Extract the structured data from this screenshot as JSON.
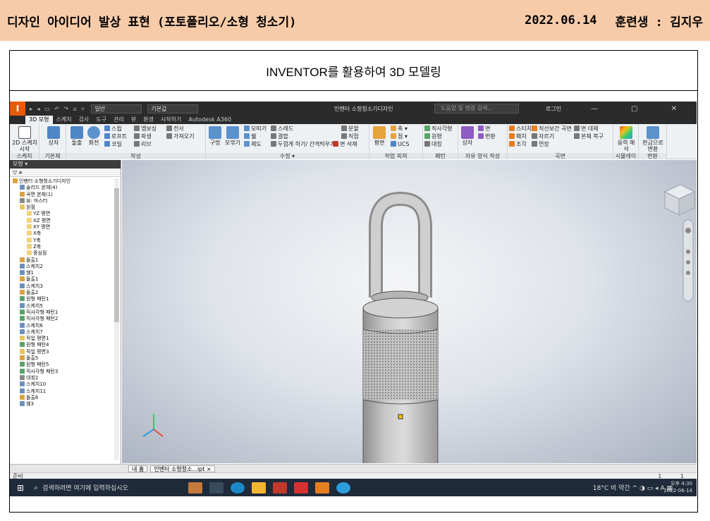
{
  "header": {
    "title": "디자인 아이디어 발상 표현 (포토폴리오/소형 청소기)",
    "date": "2022.06.14",
    "trainee": "훈련생 : 김지우"
  },
  "caption": "INVENTOR를 활용하여 3D 모델링",
  "app": {
    "logo": "I",
    "quick_access": "▸ ◂ ▭ ↶ ↷ ⌂ ▿",
    "material_select": "일반",
    "appearance_select": "기본값",
    "title": "인벤터 소형청소기디자인",
    "search_placeholder": "도움말 및 명령 검색...",
    "login": "로그인",
    "window_controls": "— ▢ ✕"
  },
  "tabs": [
    "3D 모형",
    "스케치",
    "검사",
    "도구",
    "관리",
    "뷰",
    "환경",
    "시작하기",
    "Autodesk A360"
  ],
  "active_tab": "3D 모형",
  "ribbon": {
    "groups": [
      {
        "id": "sketch",
        "label": "스케치",
        "buttons": [
          "2D 스케치 시작"
        ]
      },
      {
        "id": "base",
        "label": "기본체",
        "buttons": [
          "상자"
        ]
      },
      {
        "id": "create",
        "label": "작성",
        "buttons": [
          "돌출",
          "회전"
        ],
        "small": [
          "스윕",
          "로프트",
          "코일",
          "엠보싱",
          "파생",
          "리브",
          "전사",
          "가져오기"
        ]
      },
      {
        "id": "modify",
        "label": "수정 ▾",
        "buttons": [
          "구멍",
          "모깎기"
        ],
        "small": [
          "모따기",
          "쉘",
          "제도",
          "스레드",
          "결합",
          "두껍게 하기/ 간격띄우기",
          "분할",
          "직접",
          "면 삭제"
        ]
      },
      {
        "id": "work",
        "label": "작업 피쳐",
        "buttons": [
          "평면"
        ],
        "small": [
          "축 ▾",
          "점 ▾",
          "UCS"
        ]
      },
      {
        "id": "pattern",
        "label": "패턴",
        "small": [
          "직사각형",
          "원형",
          "대칭"
        ]
      },
      {
        "id": "freeform",
        "label": "자유 양식 작성",
        "buttons": [
          "상자"
        ],
        "small": [
          "면",
          "변환"
        ]
      },
      {
        "id": "surface",
        "label": "곡면",
        "small": [
          "스티치",
          "패치",
          "조각",
          "직선보간 곡면",
          "자르기",
          "연장",
          "면 대체",
          "본체 복구"
        ]
      },
      {
        "id": "sim",
        "label": "시뮬레이션",
        "buttons": [
          "응력 해석"
        ]
      },
      {
        "id": "convert",
        "label": "변환",
        "buttons": [
          "판금으로 변환"
        ]
      }
    ]
  },
  "browser": {
    "header": "모형 ▾",
    "tree": [
      {
        "label": "인벤터 소형청소기디자인",
        "depth": 0,
        "color": "#d9a441"
      },
      {
        "label": "솔리드 본체(4)",
        "depth": 1,
        "color": "#6b8fbf"
      },
      {
        "label": "곡면 본체(1)",
        "depth": 1,
        "color": "#d9a441"
      },
      {
        "label": "뷰: 마스터",
        "depth": 1,
        "color": "#888888"
      },
      {
        "label": "원점",
        "depth": 1,
        "color": "#e8c35a"
      },
      {
        "label": "YZ 평면",
        "depth": 2,
        "color": "#f2d27a"
      },
      {
        "label": "XZ 평면",
        "depth": 2,
        "color": "#f2d27a"
      },
      {
        "label": "XY 평면",
        "depth": 2,
        "color": "#f2d27a"
      },
      {
        "label": "X축",
        "depth": 2,
        "color": "#f2d27a"
      },
      {
        "label": "Y축",
        "depth": 2,
        "color": "#f2d27a"
      },
      {
        "label": "Z축",
        "depth": 2,
        "color": "#f2d27a"
      },
      {
        "label": "중심점",
        "depth": 2,
        "color": "#f2d27a"
      },
      {
        "label": "돌출1",
        "depth": 1,
        "color": "#d9a441"
      },
      {
        "label": "스케치2",
        "depth": 1,
        "color": "#6b8fbf"
      },
      {
        "label": "쉘1",
        "depth": 1,
        "color": "#6b8fbf"
      },
      {
        "label": "돌출1",
        "depth": 1,
        "color": "#d9a441"
      },
      {
        "label": "스케치3",
        "depth": 1,
        "color": "#6b8fbf"
      },
      {
        "label": "돌출2",
        "depth": 1,
        "color": "#d9a441"
      },
      {
        "label": "원형 패턴1",
        "depth": 1,
        "color": "#5aa36b"
      },
      {
        "label": "스케치5",
        "depth": 1,
        "color": "#6b8fbf"
      },
      {
        "label": "직사각형 패턴1",
        "depth": 1,
        "color": "#5aa36b"
      },
      {
        "label": "직사각형 패턴2",
        "depth": 1,
        "color": "#5aa36b"
      },
      {
        "label": "스케치6",
        "depth": 1,
        "color": "#6b8fbf"
      },
      {
        "label": "스케치7",
        "depth": 1,
        "color": "#6b8fbf"
      },
      {
        "label": "작업 평면1",
        "depth": 1,
        "color": "#e8c35a"
      },
      {
        "label": "원형 패턴4",
        "depth": 1,
        "color": "#5aa36b"
      },
      {
        "label": "작업 평면3",
        "depth": 1,
        "color": "#e8c35a"
      },
      {
        "label": "돌출5",
        "depth": 1,
        "color": "#d9a441"
      },
      {
        "label": "원형 패턴5",
        "depth": 1,
        "color": "#5aa36b"
      },
      {
        "label": "직사각형 패턴3",
        "depth": 1,
        "color": "#5aa36b"
      },
      {
        "label": "대칭2",
        "depth": 1,
        "color": "#888888"
      },
      {
        "label": "스케치10",
        "depth": 1,
        "color": "#6b8fbf"
      },
      {
        "label": "스케치11",
        "depth": 1,
        "color": "#6b8fbf"
      },
      {
        "label": "돌출6",
        "depth": 1,
        "color": "#d9a441"
      },
      {
        "label": "쉘3",
        "depth": 1,
        "color": "#6b8fbf"
      }
    ]
  },
  "doc_tabs": [
    "내 홈",
    "인벤터 소형청소...ipt ×"
  ],
  "status": {
    "text": "준비",
    "right": "1 1"
  },
  "taskbar": {
    "search_placeholder": "검색하려면 여기에 입력하십시오",
    "weather": "18°C 비 약간",
    "ime": "A",
    "time": "오후 4:30",
    "date": "2022-06-14"
  },
  "colors": {
    "header_bg": "#f8cba8",
    "accent": "#e8590c",
    "model": "#c4c4c4"
  }
}
